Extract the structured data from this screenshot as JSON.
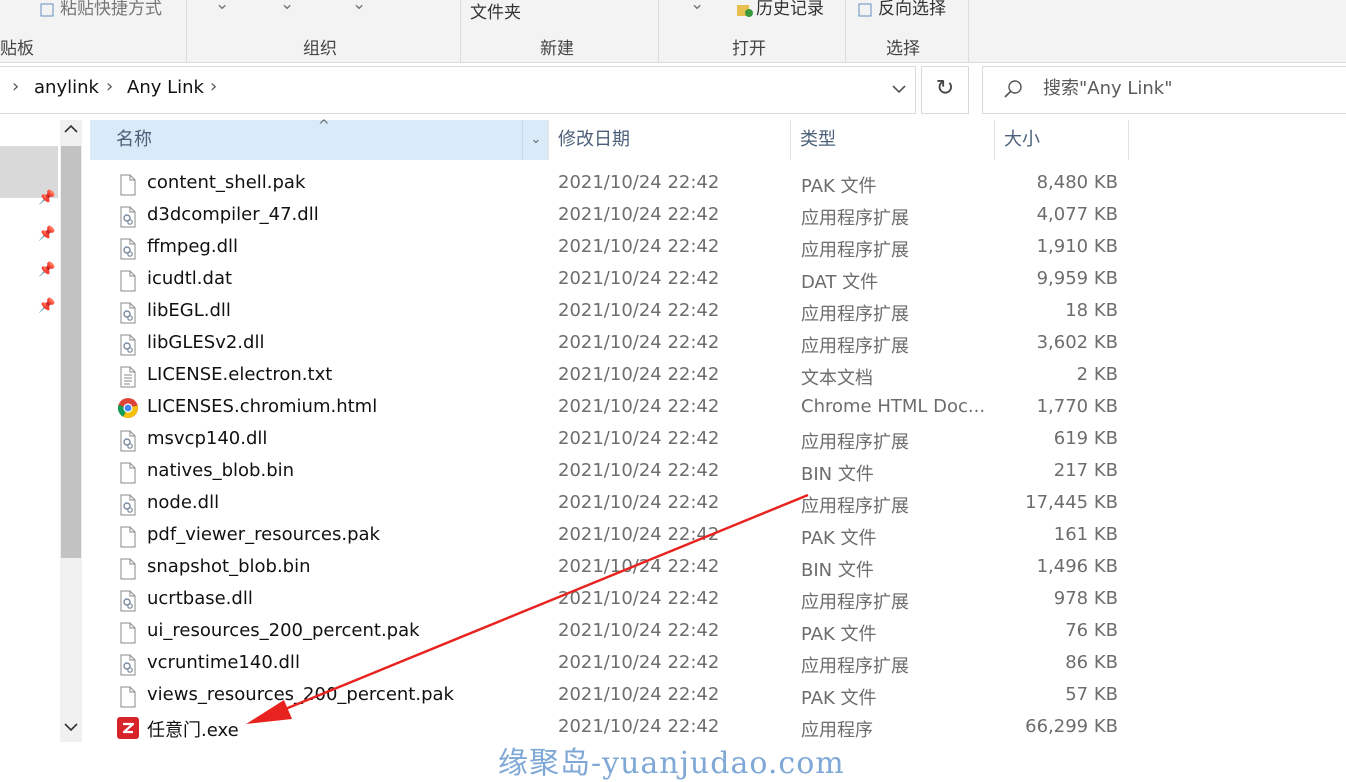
{
  "ribbon": {
    "partial_top": [
      "粘贴快捷方式",
      "文件夹",
      "历史记录",
      "反向选择"
    ],
    "groups": [
      "贴板",
      "组织",
      "新建",
      "打开",
      "选择"
    ]
  },
  "address": {
    "crumbs": [
      "anylink",
      "Any Link"
    ]
  },
  "search": {
    "placeholder": "搜索\"Any Link\""
  },
  "columns": {
    "name": "名称",
    "date": "修改日期",
    "type": "类型",
    "size": "大小"
  },
  "files": [
    {
      "name": "content_shell.pak",
      "date": "2021/10/24 22:42",
      "type": "PAK 文件",
      "size": "8,480 KB",
      "icon": "file-icon"
    },
    {
      "name": "d3dcompiler_47.dll",
      "date": "2021/10/24 22:42",
      "type": "应用程序扩展",
      "size": "4,077 KB",
      "icon": "dll-icon"
    },
    {
      "name": "ffmpeg.dll",
      "date": "2021/10/24 22:42",
      "type": "应用程序扩展",
      "size": "1,910 KB",
      "icon": "dll-icon"
    },
    {
      "name": "icudtl.dat",
      "date": "2021/10/24 22:42",
      "type": "DAT 文件",
      "size": "9,959 KB",
      "icon": "file-icon"
    },
    {
      "name": "libEGL.dll",
      "date": "2021/10/24 22:42",
      "type": "应用程序扩展",
      "size": "18 KB",
      "icon": "dll-icon"
    },
    {
      "name": "libGLESv2.dll",
      "date": "2021/10/24 22:42",
      "type": "应用程序扩展",
      "size": "3,602 KB",
      "icon": "dll-icon"
    },
    {
      "name": "LICENSE.electron.txt",
      "date": "2021/10/24 22:42",
      "type": "文本文档",
      "size": "2 KB",
      "icon": "text-file-icon"
    },
    {
      "name": "LICENSES.chromium.html",
      "date": "2021/10/24 22:42",
      "type": "Chrome HTML Doc...",
      "size": "1,770 KB",
      "icon": "chrome-icon"
    },
    {
      "name": "msvcp140.dll",
      "date": "2021/10/24 22:42",
      "type": "应用程序扩展",
      "size": "619 KB",
      "icon": "dll-icon"
    },
    {
      "name": "natives_blob.bin",
      "date": "2021/10/24 22:42",
      "type": "BIN 文件",
      "size": "217 KB",
      "icon": "file-icon"
    },
    {
      "name": "node.dll",
      "date": "2021/10/24 22:42",
      "type": "应用程序扩展",
      "size": "17,445 KB",
      "icon": "dll-icon"
    },
    {
      "name": "pdf_viewer_resources.pak",
      "date": "2021/10/24 22:42",
      "type": "PAK 文件",
      "size": "161 KB",
      "icon": "file-icon"
    },
    {
      "name": "snapshot_blob.bin",
      "date": "2021/10/24 22:42",
      "type": "BIN 文件",
      "size": "1,496 KB",
      "icon": "file-icon"
    },
    {
      "name": "ucrtbase.dll",
      "date": "2021/10/24 22:42",
      "type": "应用程序扩展",
      "size": "978 KB",
      "icon": "dll-icon"
    },
    {
      "name": "ui_resources_200_percent.pak",
      "date": "2021/10/24 22:42",
      "type": "PAK 文件",
      "size": "76 KB",
      "icon": "file-icon"
    },
    {
      "name": "vcruntime140.dll",
      "date": "2021/10/24 22:42",
      "type": "应用程序扩展",
      "size": "86 KB",
      "icon": "dll-icon"
    },
    {
      "name": "views_resources_200_percent.pak",
      "date": "2021/10/24 22:42",
      "type": "PAK 文件",
      "size": "57 KB",
      "icon": "file-icon"
    },
    {
      "name": "任意门.exe",
      "date": "2021/10/24 22:42",
      "type": "应用程序",
      "size": "66,299 KB",
      "icon": "app-z-icon"
    }
  ],
  "annotation": {
    "arrow_color": "#e8231f",
    "points_to": "任意门.exe"
  },
  "watermark": "缘聚岛-yuanjudao.com",
  "colors": {
    "header_selected": "#d9eaf8",
    "header_text": "#4c607a",
    "nav_selected": "#d9d9d9",
    "app_icon_red": "#d8232a"
  }
}
